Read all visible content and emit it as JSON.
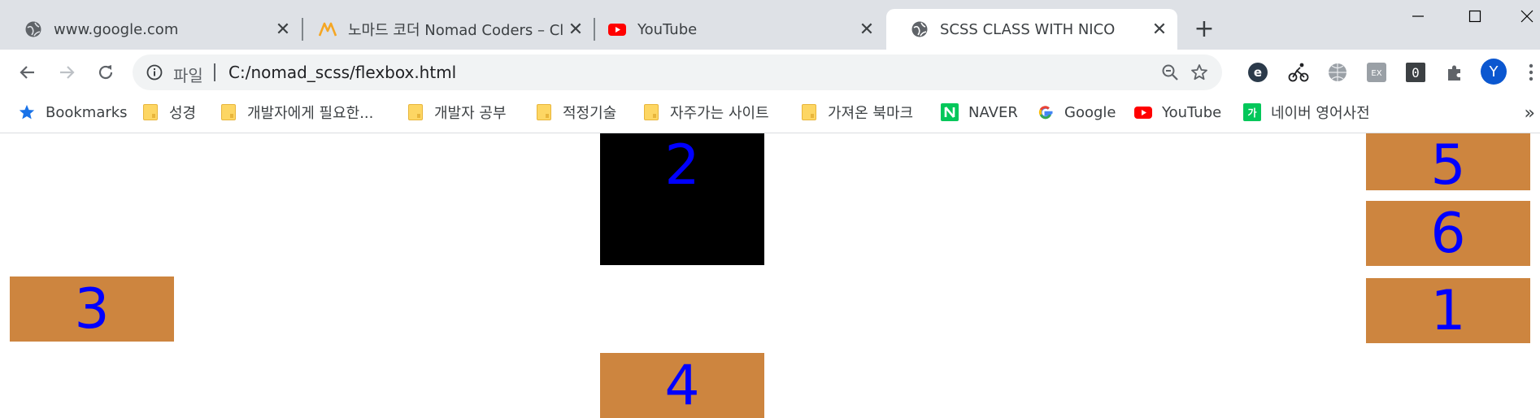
{
  "tabs": [
    {
      "title": "www.google.com",
      "icon": "globe-icon"
    },
    {
      "title": "노마드 코더 Nomad Coders – Cl",
      "icon": "nomad-coders-logo-icon"
    },
    {
      "title": "YouTube",
      "icon": "youtube-icon"
    },
    {
      "title": "SCSS CLASS WITH NICO",
      "icon": "globe-icon",
      "active": true
    }
  ],
  "new_tab_label": "+",
  "address_bar": {
    "scheme_label": "파일",
    "url": "C:/nomad_scss/flexbox.html"
  },
  "profile": {
    "initial": "Y",
    "color": "#1a73e8"
  },
  "extensions": [
    "e-extension-icon",
    "cycling-extension-icon",
    "globe-extension-icon",
    "ex-extension-icon",
    "zero-extension-icon",
    "puzzle-icon"
  ],
  "bookmarks": [
    {
      "label": "Bookmarks",
      "icon": "star-icon"
    },
    {
      "label": "성경",
      "icon": "folder-icon"
    },
    {
      "label": "개발자에게 필요한...",
      "icon": "folder-icon"
    },
    {
      "label": "개발자 공부",
      "icon": "folder-icon"
    },
    {
      "label": "적정기술",
      "icon": "folder-icon"
    },
    {
      "label": "자주가는 사이트",
      "icon": "folder-icon"
    },
    {
      "label": "가져온 북마크",
      "icon": "folder-icon"
    },
    {
      "label": "NAVER",
      "icon": "naver-icon"
    },
    {
      "label": "Google",
      "icon": "google-icon"
    },
    {
      "label": "YouTube",
      "icon": "youtube-icon"
    },
    {
      "label": "네이버 영어사전",
      "icon": "naver-dictionary-icon"
    }
  ],
  "bookmarks_overflow": "»",
  "page": {
    "box_color": "#cd853f",
    "highlight_color": "#000000",
    "text_color": "#0000ff",
    "boxes": [
      {
        "label": "1"
      },
      {
        "label": "2"
      },
      {
        "label": "3"
      },
      {
        "label": "4"
      },
      {
        "label": "5"
      },
      {
        "label": "6"
      }
    ]
  }
}
